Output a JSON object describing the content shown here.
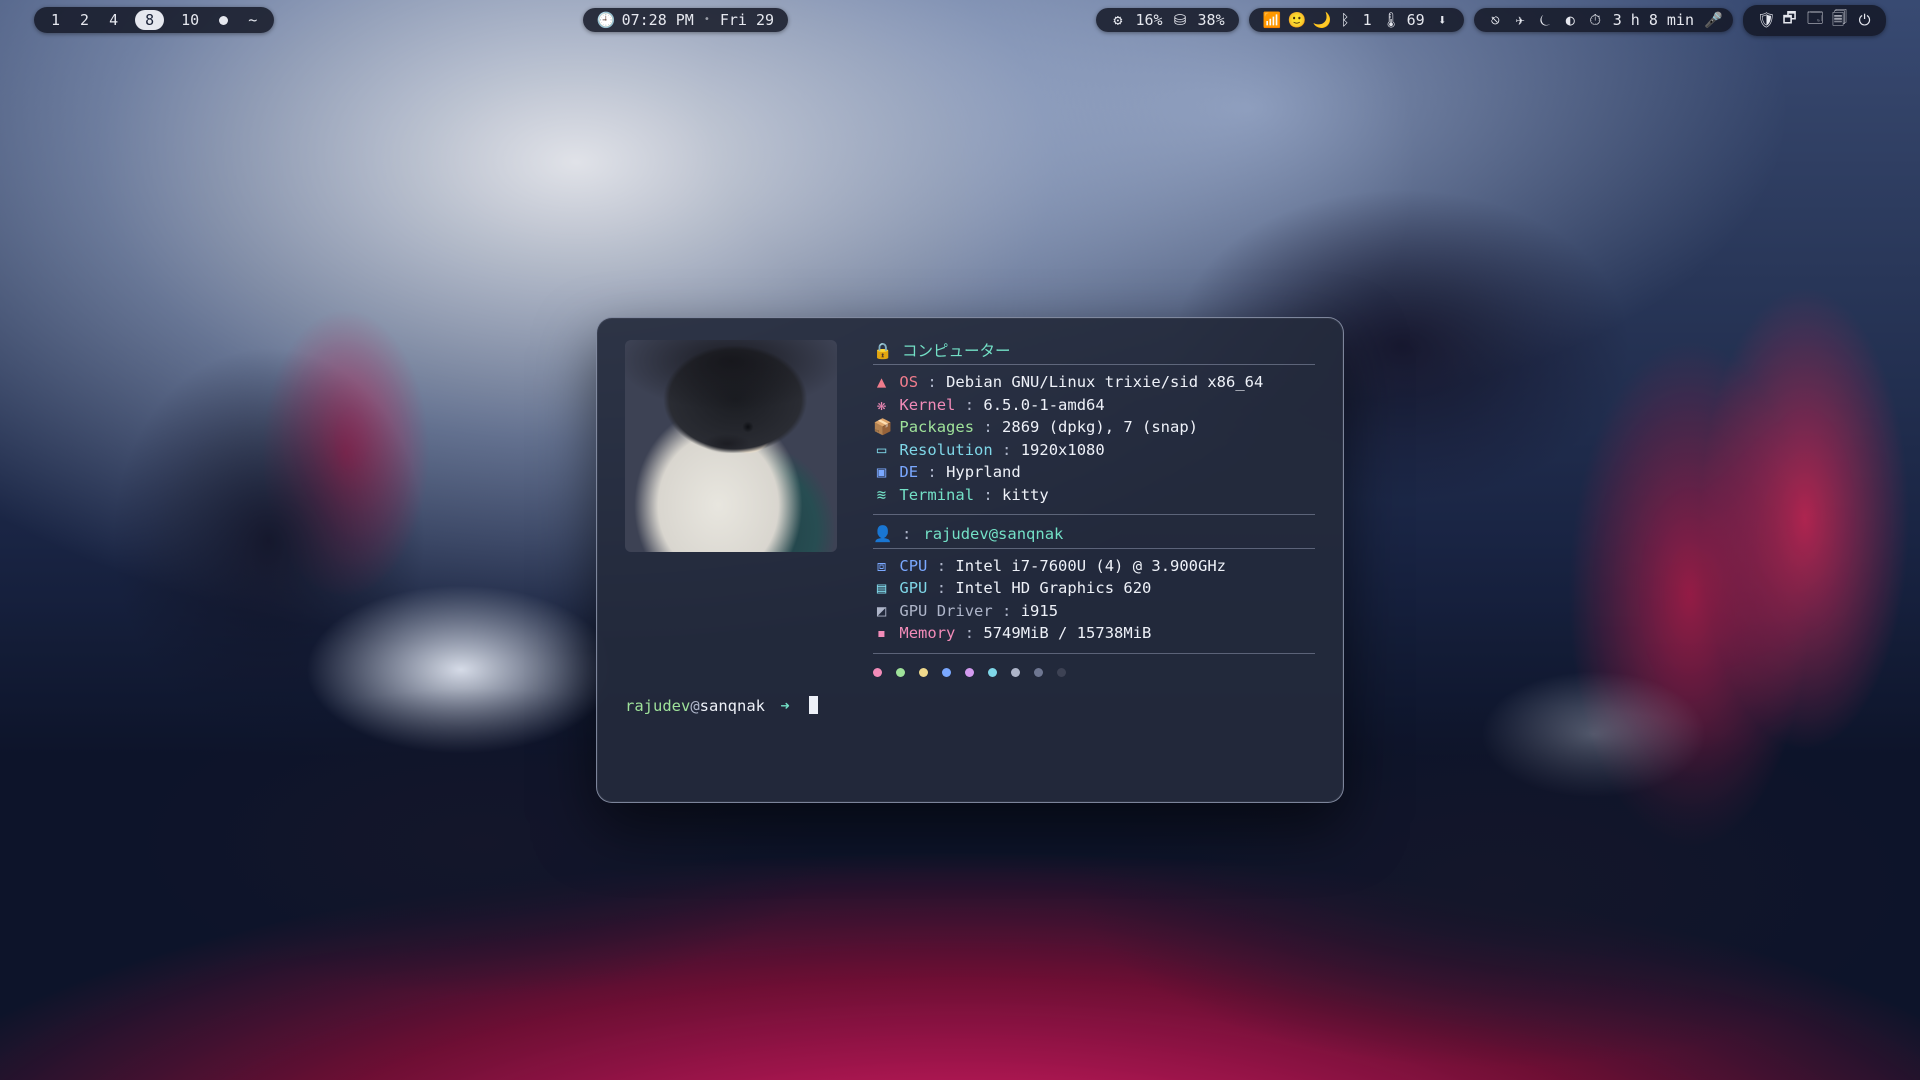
{
  "topbar": {
    "workspaces": {
      "items": [
        "1",
        "2",
        "4",
        "8",
        "10",
        "~"
      ],
      "active_index": 3
    },
    "clock": {
      "icon": "🕘",
      "time": "07:28 PM",
      "day": "Fri 29"
    },
    "sys": {
      "cpu_icon": "⚙",
      "cpu": "16%",
      "ram_icon": "⛁",
      "ram": "38%"
    },
    "net": {
      "wifi_icon": "📶",
      "face_icon": "🙂",
      "moon_icon": "🌙",
      "bt_icon": "ᛒ",
      "bt_count": "1",
      "temp_icon": "🌡",
      "temp": "69",
      "dl_icon": "⬇"
    },
    "uptime": {
      "i1": "⎋",
      "i2": "✈",
      "i3": "⏾",
      "i4": "◐",
      "clock_icon": "⏱",
      "text": "3 h 8 min",
      "mic_icon": "🎤"
    },
    "tray": {
      "i1": "🛡",
      "i2": "🗗",
      "i3": "🗔",
      "i4": "🗐",
      "i5": "⏻"
    }
  },
  "terminal": {
    "section1": {
      "icon": "🔒",
      "title": "コンピューター"
    },
    "rows1": [
      {
        "cls": "c-red",
        "icon": "▲",
        "key": "OS",
        "val": "Debian GNU/Linux trixie/sid x86_64"
      },
      {
        "cls": "c-pink",
        "icon": "❋",
        "key": "Kernel",
        "val": "6.5.0-1-amd64"
      },
      {
        "cls": "c-green",
        "icon": "📦",
        "key": "Packages",
        "val": "2869 (dpkg), 7 (snap)"
      },
      {
        "cls": "c-cyan",
        "icon": "▭",
        "key": "Resolution",
        "val": "1920x1080"
      },
      {
        "cls": "c-blue",
        "icon": "▣",
        "key": "DE",
        "val": "Hyprland"
      },
      {
        "cls": "c-teal",
        "icon": "≋",
        "key": "Terminal",
        "val": "kitty"
      }
    ],
    "section2": {
      "icon": "👤",
      "userhost": "rajudev@sanqnak"
    },
    "rows2": [
      {
        "cls": "c-blue",
        "icon": "⧈",
        "key": "CPU",
        "val": "Intel i7-7600U (4) @ 3.900GHz"
      },
      {
        "cls": "c-cyan",
        "icon": "▤",
        "key": "GPU",
        "val": "Intel HD Graphics 620"
      },
      {
        "cls": "c-gray",
        "icon": "◩",
        "key": "GPU Driver",
        "val": "i915"
      },
      {
        "cls": "c-pink",
        "icon": "▪",
        "key": "Memory",
        "val": "5749MiB / 15738MiB"
      }
    ],
    "palette": [
      "#f28bb8",
      "#9fe29a",
      "#f0d98c",
      "#7aa8ff",
      "#d49bf0",
      "#7fd7e8",
      "#aeb5c9",
      "#6e7691",
      "#3d4254"
    ],
    "prompt": {
      "user": "rajudev",
      "host": "sanqnak",
      "arrow": "➜"
    }
  }
}
